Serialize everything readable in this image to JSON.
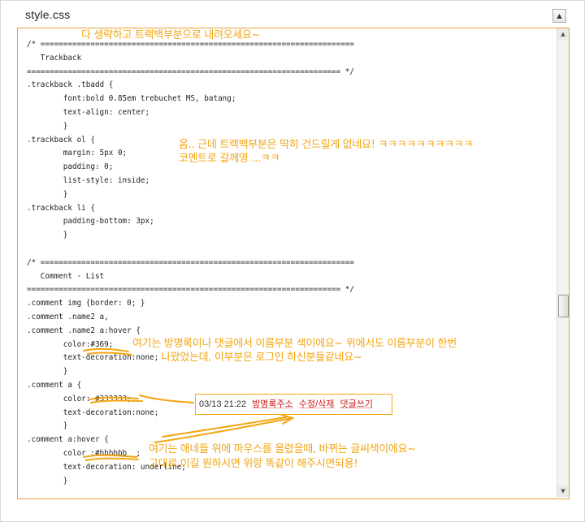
{
  "file_title": "style.css",
  "collapse_icon": "▲",
  "code_lines": [
    "/* =====================================================================",
    "   Trackback",
    "===================================================================== */",
    ".trackback .tbadd {",
    "        font:bold 0.85em trebuchet MS, batang;",
    "        text-align: center;",
    "        }",
    ".trackback ol {",
    "        margin: 5px 0;",
    "        padding: 0;",
    "        list-style: inside;",
    "        }",
    ".trackback li {",
    "        padding-bottom: 3px;",
    "        }",
    "",
    "/* =====================================================================",
    "   Comment - List",
    "===================================================================== */",
    ".comment img {border: 0; }",
    ".comment .name2 a,",
    ".comment .name2 a:hover {",
    "        color:#369;",
    "        text-decoration:none;",
    "        }",
    ".comment a {",
    "        color: #333333;",
    "        text-decoration:none;",
    "        }",
    ".comment a:hover {",
    "        color :#bbbbbb  ;",
    "        text-decoration: underline;",
    "        }"
  ],
  "annotations": {
    "note1": "다 생략하고 트랙백부분으로 내려오세요~",
    "note2_line1": "음.. 근데 트랙백부분은 딱히 건드릴게 없네요! ㅋㅋㅋㅋㅋㅋㅋㅋㅋㅋ",
    "note2_line2": "코멘트로 갈께영 ...ㅋㅋ",
    "note3_line1": "여기는 방명록이나 댓글에서 이름부분 색이에요~  위에서도 이름부분이 한번",
    "note3_line2": "나왔었는데, 이부분은 로그인 하신분들같네요~",
    "note4_line1": "여기는 애네들 위에 마우스를 올렸을때, 바뀌는 글씨색이에요~",
    "note4_line2": "그대로 이길 원하시면 위랑 똑같이 해주시면되용!"
  },
  "preview": {
    "time": "03/13 21:22",
    "link_guestbook": "방명록주소",
    "link_edit": "수정/삭제",
    "link_reply": "댓글쓰기"
  },
  "colors": {
    "annotation": "#f3a512",
    "editor_border": "#e8a23a",
    "link_red": "#cc1b1b"
  },
  "icons": {
    "scroll_up": "▲",
    "scroll_down": "▼"
  }
}
